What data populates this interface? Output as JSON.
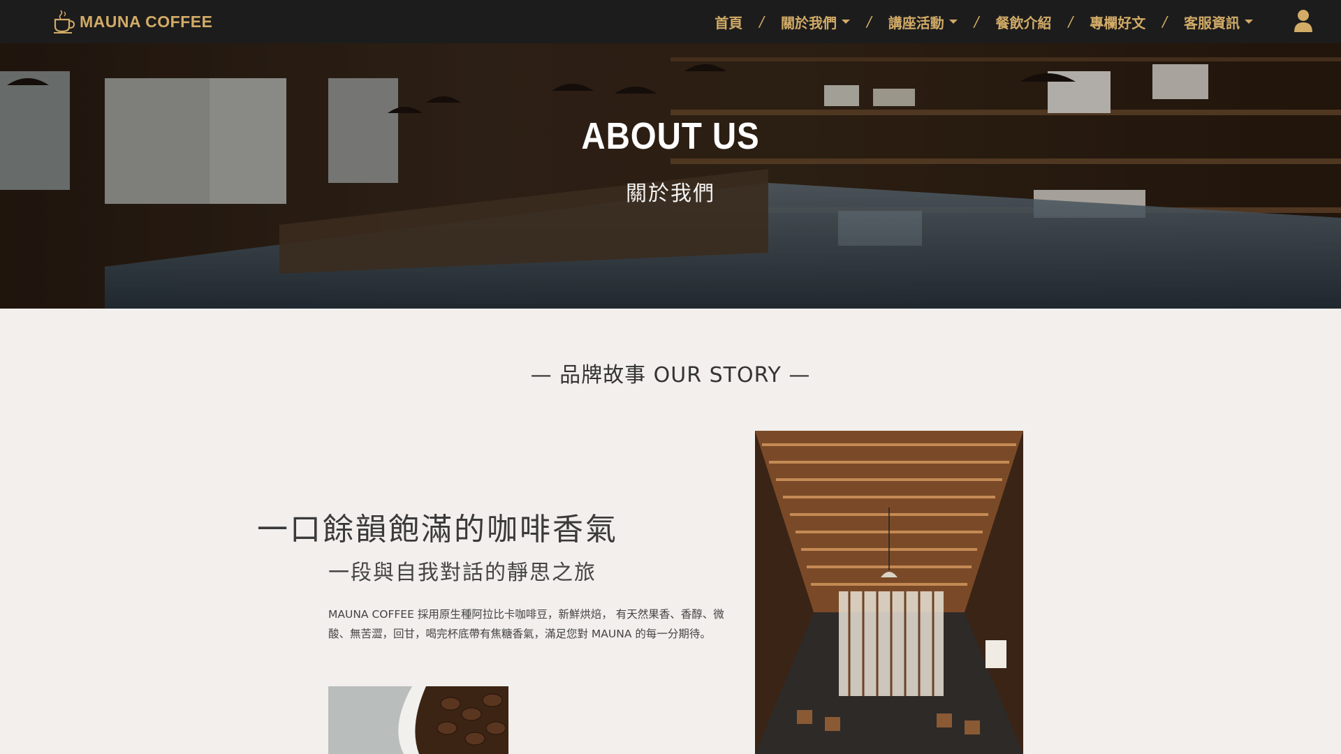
{
  "brand": {
    "name": "MAUNA COFFEE",
    "color": "#d2ab67"
  },
  "nav": {
    "items": [
      {
        "label": "首頁",
        "dropdown": false
      },
      {
        "label": "關於我們",
        "dropdown": true
      },
      {
        "label": "講座活動",
        "dropdown": true
      },
      {
        "label": "餐飲介紹",
        "dropdown": false
      },
      {
        "label": "專欄好文",
        "dropdown": false
      },
      {
        "label": "客服資訊",
        "dropdown": true
      }
    ],
    "separator": "/",
    "user_icon": "user-icon"
  },
  "hero": {
    "title": "ABOUT US",
    "subtitle": "關於我們"
  },
  "story": {
    "heading": "— 品牌故事 OUR STORY —",
    "main_title": "一口餘韻飽滿的咖啡香氣",
    "sub_title": "一段與自我對話的靜思之旅",
    "body": "MAUNA COFFEE 採用原生種阿拉比卡咖啡豆，新鮮烘焙， 有天然果香、香醇、微酸、無苦澀，回甘，喝完杯底帶有焦糖香氣，滿足您對 MAUNA 的每一分期待。"
  }
}
